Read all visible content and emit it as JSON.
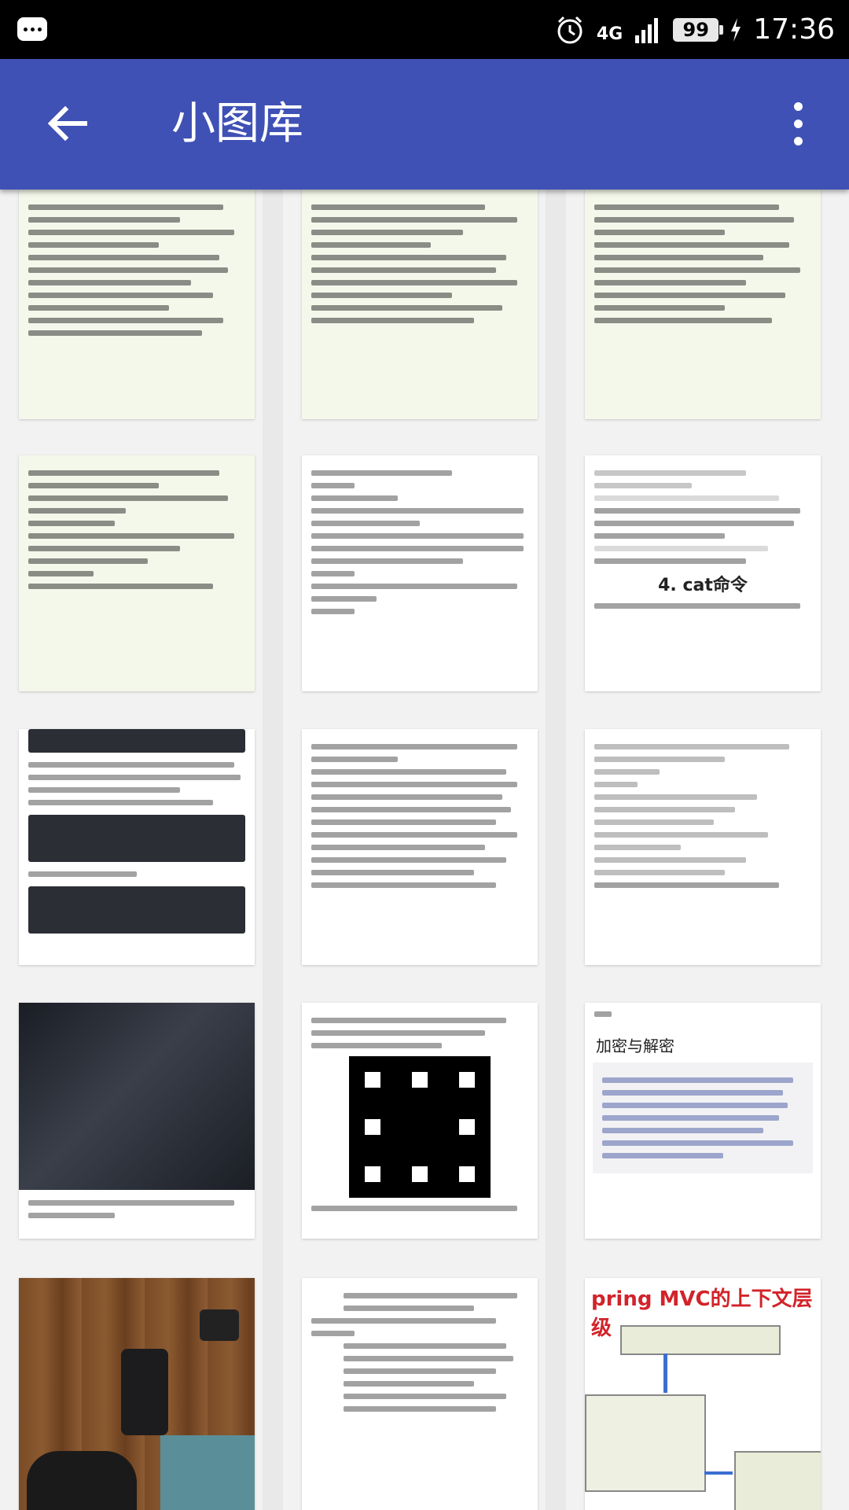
{
  "status_bar": {
    "network": "4G",
    "battery": "99",
    "time": "17:36",
    "icons": [
      "notification-icon",
      "alarm-icon",
      "signal-icon",
      "charging-icon"
    ]
  },
  "app_bar": {
    "title": "小图库",
    "color": "#3f51b5",
    "back_icon": "arrow-left-icon",
    "menu_icon": "more-vert-icon"
  },
  "gallery": {
    "columns": 3,
    "thumbnails": [
      {
        "kind": "english-essay-notes"
      },
      {
        "kind": "english-essay-notes"
      },
      {
        "kind": "english-essay-notes"
      },
      {
        "kind": "english-essay-notes"
      },
      {
        "kind": "text-document"
      },
      {
        "kind": "command-line-doc"
      },
      {
        "kind": "mysql-doc"
      },
      {
        "kind": "chinese-text-doc"
      },
      {
        "kind": "python-code-doc"
      },
      {
        "kind": "dark-photo"
      },
      {
        "kind": "fractal-doc"
      },
      {
        "kind": "objc-code-doc"
      },
      {
        "kind": "wood-photo"
      },
      {
        "kind": "chinese-list-doc"
      },
      {
        "kind": "spring-mvc-diagram"
      }
    ],
    "visible_headings": [
      "加密与解密",
      "4. cat命令",
      "pring MVC的上下文层级"
    ]
  }
}
